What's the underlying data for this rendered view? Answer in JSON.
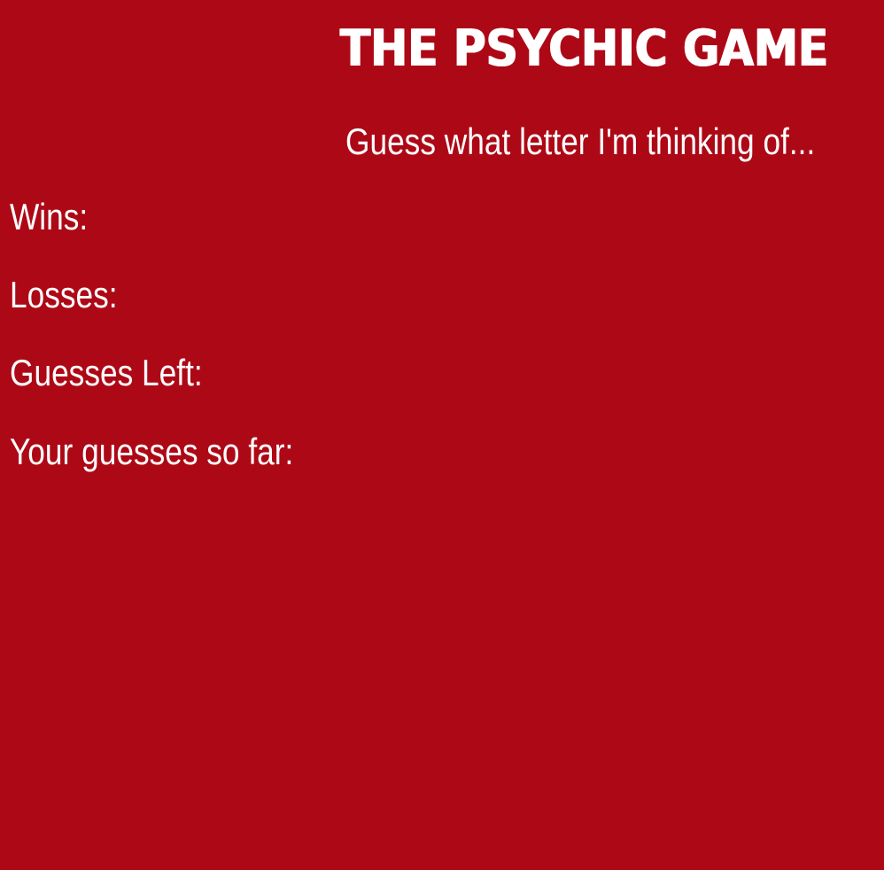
{
  "header": {
    "title": "The Psychic Game",
    "subtitle": "Guess what letter I'm thinking of..."
  },
  "stats": {
    "wins_label": "Wins:",
    "wins_value": "",
    "losses_label": "Losses:",
    "losses_value": "",
    "guesses_left_label": "Guesses Left:",
    "guesses_left_value": "",
    "guesses_so_far_label": "Your guesses so far:",
    "guesses_so_far_value": ""
  },
  "colors": {
    "background": "#ad0816",
    "text": "#ffffff"
  }
}
